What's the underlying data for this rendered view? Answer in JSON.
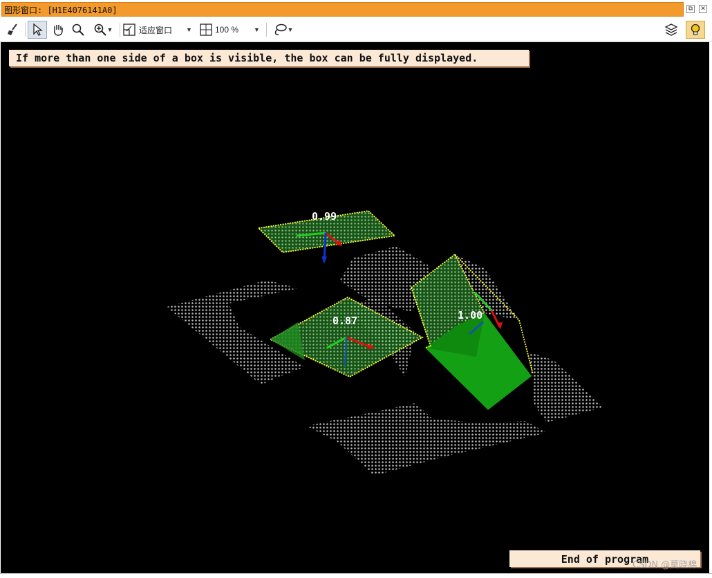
{
  "window": {
    "title": "图形窗口: [H1E4076141A0]",
    "restore_label": "⧉",
    "close_label": "✕"
  },
  "toolbar": {
    "fit_window_label": "适应窗口",
    "zoom_value": "100 %",
    "icons": [
      "broom-icon",
      "pointer-icon",
      "hand-icon",
      "magnifier-icon",
      "zoom-in-icon",
      "fit-window-icon",
      "zoom-percent-icon",
      "lasso-icon",
      "layers-icon",
      "lightbulb-icon"
    ]
  },
  "canvas": {
    "message": "If more than one side of a box is visible, the box can be fully displayed.",
    "end_label": "End of program",
    "box_scores": [
      "0.99",
      "0.87",
      "1.00"
    ]
  },
  "watermark": "CSDN @莫晓棉",
  "colors": {
    "titlebar": "#f39a2c",
    "canvas_bg": "#000000",
    "points": "#d9d9d9",
    "box_fill": "#2a9a2a",
    "box_edge": "#ffff33",
    "axis_x": "#dd1111",
    "axis_y": "#22cc22",
    "axis_z": "#1133cc",
    "message_bg": "#fbe9d6"
  }
}
